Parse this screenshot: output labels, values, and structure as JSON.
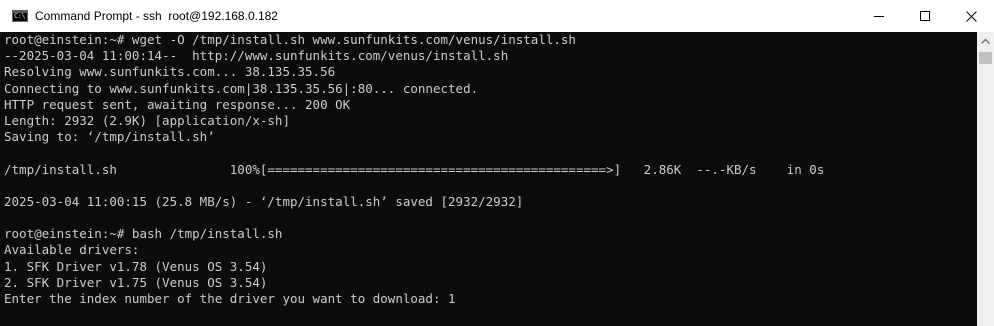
{
  "window": {
    "title": "Command Prompt - ssh  root@192.168.0.182",
    "icon": "cmd-icon",
    "icon_glyph": "C:\\"
  },
  "controls": {
    "minimize_icon": "minimize-icon",
    "maximize_icon": "maximize-icon",
    "close_icon": "close-icon"
  },
  "terminal": {
    "lines": [
      "root@einstein:~# wget -O /tmp/install.sh www.sunfunkits.com/venus/install.sh",
      "--2025-03-04 11:00:14--  http://www.sunfunkits.com/venus/install.sh",
      "Resolving www.sunfunkits.com... 38.135.35.56",
      "Connecting to www.sunfunkits.com|38.135.35.56|:80... connected.",
      "HTTP request sent, awaiting response... 200 OK",
      "Length: 2932 (2.9K) [application/x-sh]",
      "Saving to: ‘/tmp/install.sh’",
      "",
      "/tmp/install.sh               100%[=============================================>]   2.86K  --.-KB/s    in 0s",
      "",
      "2025-03-04 11:00:15 (25.8 MB/s) - ‘/tmp/install.sh’ saved [2932/2932]",
      "",
      "root@einstein:~# bash /tmp/install.sh",
      "Available drivers:",
      "1. SFK Driver v1.78 (Venus OS 3.54)",
      "2. SFK Driver v1.75 (Venus OS 3.54)",
      "Enter the index number of the driver you want to download: 1"
    ]
  },
  "colors": {
    "terminal_bg": "#0c0c0c",
    "terminal_fg": "#cccccc",
    "titlebar_bg": "#ffffff",
    "scrollbar_bg": "#f0f0f0",
    "scrollbar_thumb": "#c1c1c1"
  }
}
